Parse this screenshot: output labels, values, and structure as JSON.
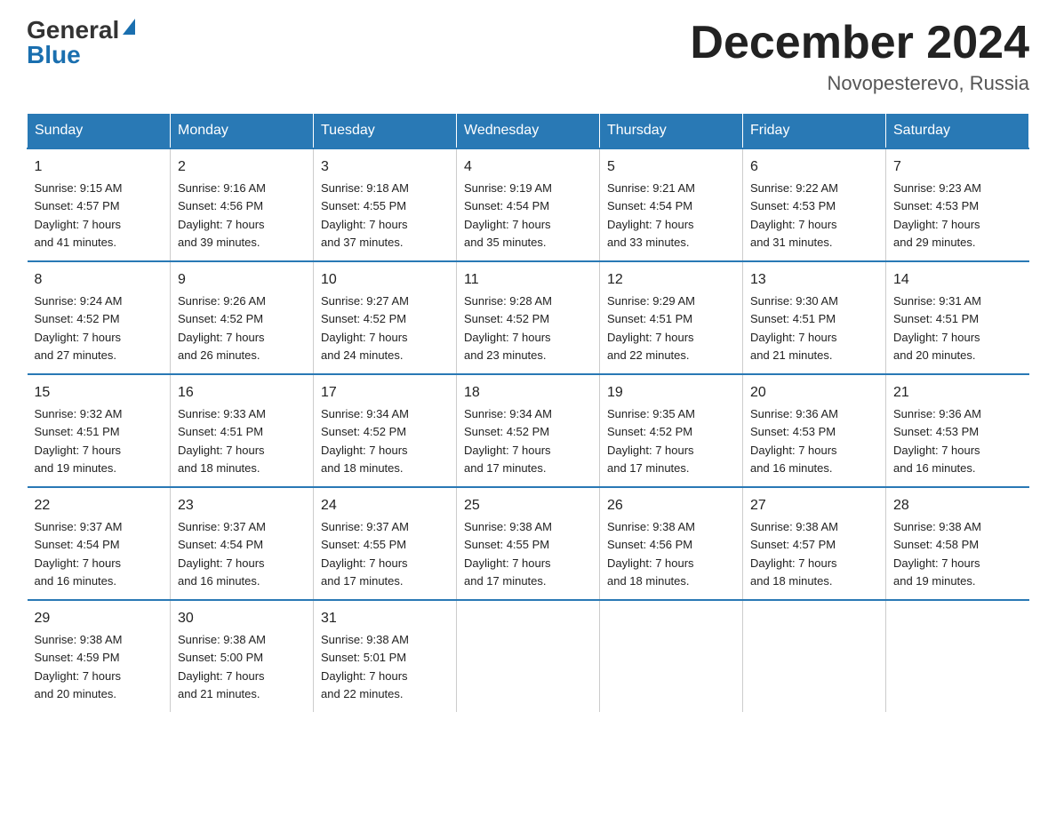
{
  "logo": {
    "general": "General",
    "blue": "Blue"
  },
  "header": {
    "month_year": "December 2024",
    "location": "Novopesterevo, Russia"
  },
  "days_of_week": [
    "Sunday",
    "Monday",
    "Tuesday",
    "Wednesday",
    "Thursday",
    "Friday",
    "Saturday"
  ],
  "weeks": [
    [
      {
        "day": "1",
        "sunrise": "9:15 AM",
        "sunset": "4:57 PM",
        "daylight": "7 hours and 41 minutes."
      },
      {
        "day": "2",
        "sunrise": "9:16 AM",
        "sunset": "4:56 PM",
        "daylight": "7 hours and 39 minutes."
      },
      {
        "day": "3",
        "sunrise": "9:18 AM",
        "sunset": "4:55 PM",
        "daylight": "7 hours and 37 minutes."
      },
      {
        "day": "4",
        "sunrise": "9:19 AM",
        "sunset": "4:54 PM",
        "daylight": "7 hours and 35 minutes."
      },
      {
        "day": "5",
        "sunrise": "9:21 AM",
        "sunset": "4:54 PM",
        "daylight": "7 hours and 33 minutes."
      },
      {
        "day": "6",
        "sunrise": "9:22 AM",
        "sunset": "4:53 PM",
        "daylight": "7 hours and 31 minutes."
      },
      {
        "day": "7",
        "sunrise": "9:23 AM",
        "sunset": "4:53 PM",
        "daylight": "7 hours and 29 minutes."
      }
    ],
    [
      {
        "day": "8",
        "sunrise": "9:24 AM",
        "sunset": "4:52 PM",
        "daylight": "7 hours and 27 minutes."
      },
      {
        "day": "9",
        "sunrise": "9:26 AM",
        "sunset": "4:52 PM",
        "daylight": "7 hours and 26 minutes."
      },
      {
        "day": "10",
        "sunrise": "9:27 AM",
        "sunset": "4:52 PM",
        "daylight": "7 hours and 24 minutes."
      },
      {
        "day": "11",
        "sunrise": "9:28 AM",
        "sunset": "4:52 PM",
        "daylight": "7 hours and 23 minutes."
      },
      {
        "day": "12",
        "sunrise": "9:29 AM",
        "sunset": "4:51 PM",
        "daylight": "7 hours and 22 minutes."
      },
      {
        "day": "13",
        "sunrise": "9:30 AM",
        "sunset": "4:51 PM",
        "daylight": "7 hours and 21 minutes."
      },
      {
        "day": "14",
        "sunrise": "9:31 AM",
        "sunset": "4:51 PM",
        "daylight": "7 hours and 20 minutes."
      }
    ],
    [
      {
        "day": "15",
        "sunrise": "9:32 AM",
        "sunset": "4:51 PM",
        "daylight": "7 hours and 19 minutes."
      },
      {
        "day": "16",
        "sunrise": "9:33 AM",
        "sunset": "4:51 PM",
        "daylight": "7 hours and 18 minutes."
      },
      {
        "day": "17",
        "sunrise": "9:34 AM",
        "sunset": "4:52 PM",
        "daylight": "7 hours and 18 minutes."
      },
      {
        "day": "18",
        "sunrise": "9:34 AM",
        "sunset": "4:52 PM",
        "daylight": "7 hours and 17 minutes."
      },
      {
        "day": "19",
        "sunrise": "9:35 AM",
        "sunset": "4:52 PM",
        "daylight": "7 hours and 17 minutes."
      },
      {
        "day": "20",
        "sunrise": "9:36 AM",
        "sunset": "4:53 PM",
        "daylight": "7 hours and 16 minutes."
      },
      {
        "day": "21",
        "sunrise": "9:36 AM",
        "sunset": "4:53 PM",
        "daylight": "7 hours and 16 minutes."
      }
    ],
    [
      {
        "day": "22",
        "sunrise": "9:37 AM",
        "sunset": "4:54 PM",
        "daylight": "7 hours and 16 minutes."
      },
      {
        "day": "23",
        "sunrise": "9:37 AM",
        "sunset": "4:54 PM",
        "daylight": "7 hours and 16 minutes."
      },
      {
        "day": "24",
        "sunrise": "9:37 AM",
        "sunset": "4:55 PM",
        "daylight": "7 hours and 17 minutes."
      },
      {
        "day": "25",
        "sunrise": "9:38 AM",
        "sunset": "4:55 PM",
        "daylight": "7 hours and 17 minutes."
      },
      {
        "day": "26",
        "sunrise": "9:38 AM",
        "sunset": "4:56 PM",
        "daylight": "7 hours and 18 minutes."
      },
      {
        "day": "27",
        "sunrise": "9:38 AM",
        "sunset": "4:57 PM",
        "daylight": "7 hours and 18 minutes."
      },
      {
        "day": "28",
        "sunrise": "9:38 AM",
        "sunset": "4:58 PM",
        "daylight": "7 hours and 19 minutes."
      }
    ],
    [
      {
        "day": "29",
        "sunrise": "9:38 AM",
        "sunset": "4:59 PM",
        "daylight": "7 hours and 20 minutes."
      },
      {
        "day": "30",
        "sunrise": "9:38 AM",
        "sunset": "5:00 PM",
        "daylight": "7 hours and 21 minutes."
      },
      {
        "day": "31",
        "sunrise": "9:38 AM",
        "sunset": "5:01 PM",
        "daylight": "7 hours and 22 minutes."
      },
      null,
      null,
      null,
      null
    ]
  ],
  "labels": {
    "sunrise": "Sunrise:",
    "sunset": "Sunset:",
    "daylight": "Daylight:"
  }
}
